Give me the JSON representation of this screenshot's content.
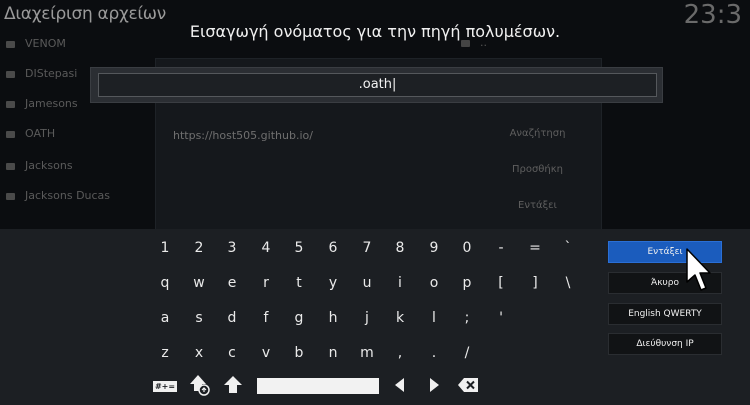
{
  "background": {
    "title": "Διαχείριση αρχείων",
    "clock": "23:3",
    "sidebar_items": [
      "VENOM",
      "DIStepasi",
      "Jamesons",
      "OATH",
      "Jacksons",
      "Jacksons Ducas"
    ],
    "source_url": "https://host505.github.io/",
    "right_folder": "..",
    "panel_buttons": [
      "Αναζήτηση",
      "Προσθήκη",
      "Εντάξει"
    ]
  },
  "dialog": {
    "heading": "Εισαγωγή ονόματος για την πηγή πολυμέσων.",
    "input_value": ".oath|"
  },
  "keyboard": {
    "rows": [
      [
        "1",
        "2",
        "3",
        "4",
        "5",
        "6",
        "7",
        "8",
        "9",
        "0",
        "-",
        "=",
        "`"
      ],
      [
        "q",
        "w",
        "e",
        "r",
        "t",
        "y",
        "u",
        "i",
        "o",
        "p",
        "[",
        "]",
        "\\"
      ],
      [
        "a",
        "s",
        "d",
        "f",
        "g",
        "h",
        "j",
        "k",
        "l",
        ";",
        "'"
      ],
      [
        "z",
        "x",
        "c",
        "v",
        "b",
        "n",
        "m",
        ",",
        ".",
        "/"
      ]
    ],
    "icons": {
      "symbols": "#+=",
      "shift_lock": "shift-lock-icon",
      "shift": "shift-icon",
      "left": "left-arrow-icon",
      "right": "right-arrow-icon",
      "backspace": "backspace-icon"
    },
    "side_buttons": {
      "ok": "Εντάξει",
      "cancel": "Άκυρο",
      "layout": "English QWERTY",
      "ip": "Διεύθυνση IP"
    }
  },
  "colors": {
    "accent": "#1b5cbd",
    "keyboard_bg": "#1c1f23"
  }
}
